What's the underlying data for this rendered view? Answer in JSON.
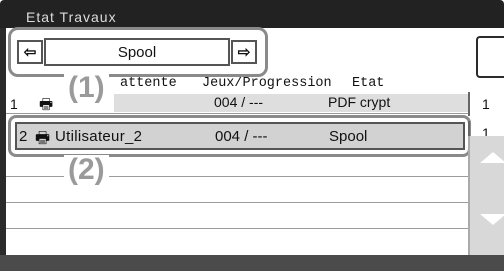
{
  "window": {
    "title": "Etat Travaux"
  },
  "selector": {
    "value": "Spool",
    "left_arrow": "⇦",
    "right_arrow": "⇨"
  },
  "markers": {
    "one": "(1)",
    "two": "(2)"
  },
  "table": {
    "headers": {
      "queue": "attente",
      "sets_progress": "Jeux/Progression",
      "status": "Etat"
    },
    "rows": [
      {
        "num": "1",
        "name": "",
        "progress": "004 / ---",
        "status": "PDF crypt"
      },
      {
        "num": "2",
        "name": "Utilisateur_2",
        "progress": "004 / ---",
        "status": "Spool"
      }
    ],
    "counts": [
      "1",
      "1"
    ]
  },
  "icons": {
    "job": "print-job-icon",
    "scroll_up": "up-arrow-icon",
    "scroll_down": "down-arrow-icon"
  },
  "colors": {
    "title_bar": "#222222",
    "selected_row": "#d2d2d2",
    "callout_border": "#8a8a8a",
    "scroll_panel": "#d8d8d8"
  }
}
